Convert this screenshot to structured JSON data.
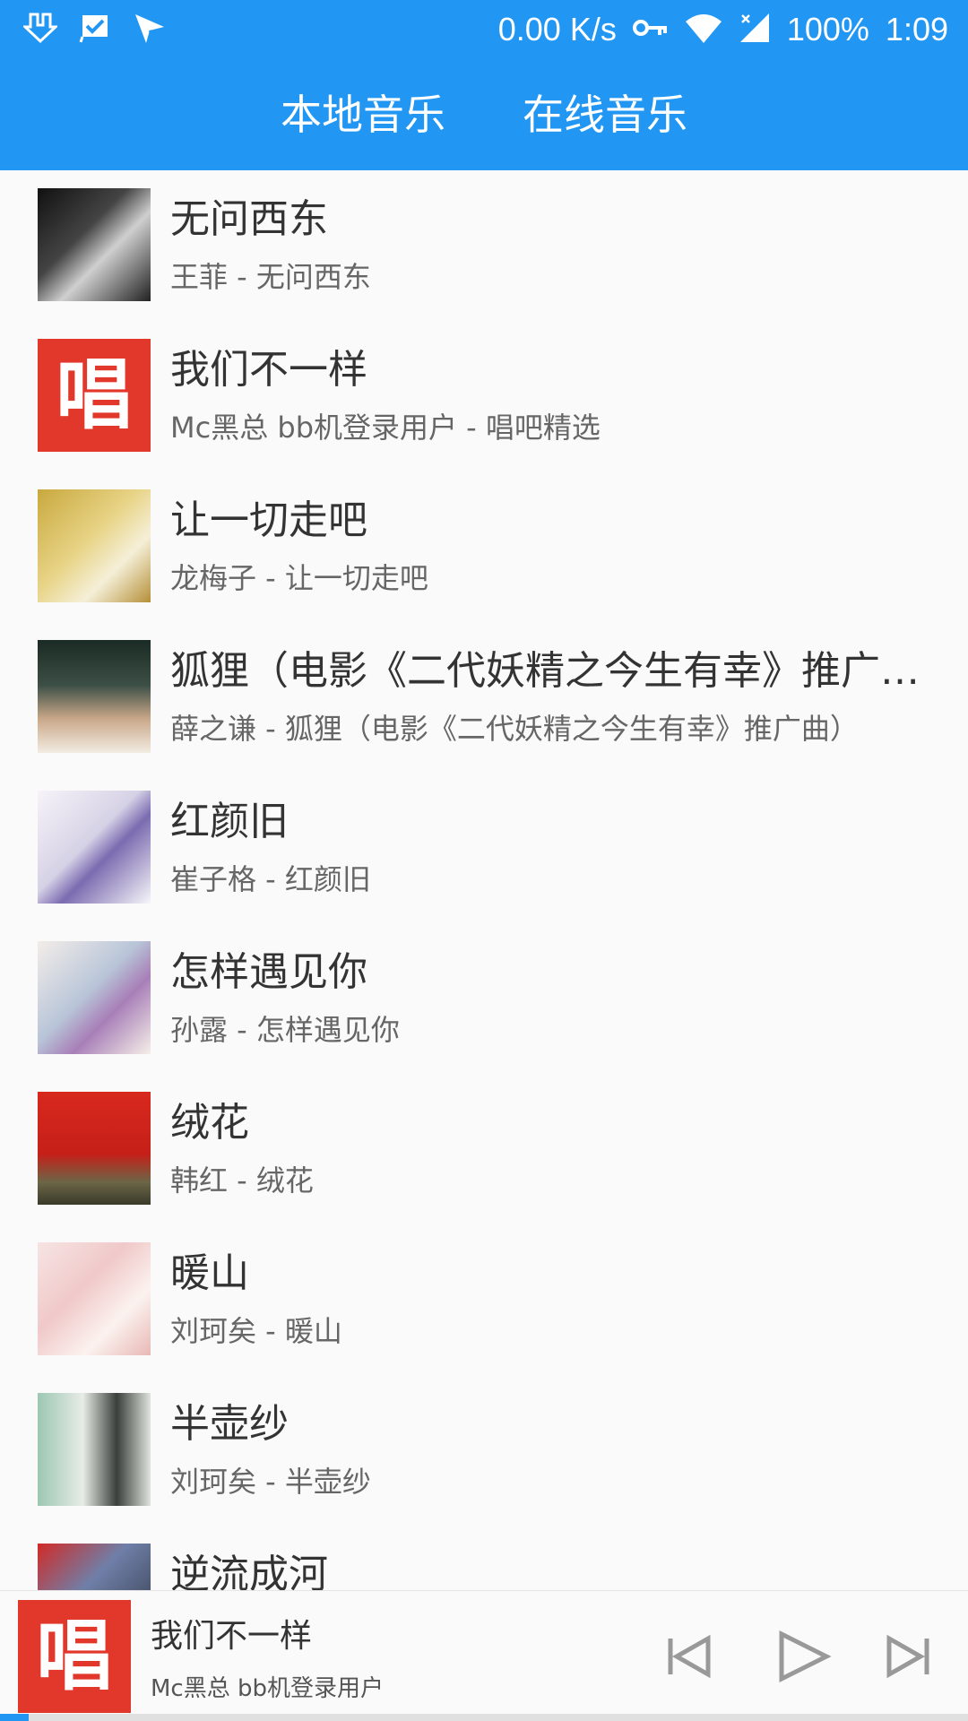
{
  "status_bar": {
    "network_speed": "0.00 K/s",
    "battery": "100%",
    "time": "1:09",
    "icons": [
      "download-icon",
      "check-flag-icon",
      "send-icon",
      "vpn-key-icon",
      "wifi-icon",
      "cell-signal-icon"
    ]
  },
  "tabs": [
    {
      "label": "本地音乐"
    },
    {
      "label": "在线音乐"
    }
  ],
  "songs": [
    {
      "title": "无问西东",
      "subtitle": "王菲 - 无问西东"
    },
    {
      "title": "我们不一样",
      "subtitle": "Mc黑总 bb机登录用户 - 唱吧精选"
    },
    {
      "title": "让一切走吧",
      "subtitle": "龙梅子 - 让一切走吧"
    },
    {
      "title": "狐狸（电影《二代妖精之今生有幸》推广曲）",
      "subtitle": "薛之谦 - 狐狸（电影《二代妖精之今生有幸》推广曲）"
    },
    {
      "title": "红颜旧",
      "subtitle": "崔子格 - 红颜旧"
    },
    {
      "title": "怎样遇见你",
      "subtitle": "孙露 - 怎样遇见你"
    },
    {
      "title": "绒花",
      "subtitle": "韩红 - 绒花"
    },
    {
      "title": "暖山",
      "subtitle": "刘珂矣 - 暖山"
    },
    {
      "title": "半壶纱",
      "subtitle": "刘珂矣 - 半壶纱"
    },
    {
      "title": "逆流成河",
      "subtitle": ""
    }
  ],
  "cover_glyphs": {
    "chang": "唱"
  },
  "mini_player": {
    "title": "我们不一样",
    "artist": "Mc黑总 bb机登录用户",
    "cover_glyph": "唱",
    "progress": 0.03
  },
  "colors": {
    "primary": "#2196f3",
    "chang_red": "#e2382c"
  }
}
